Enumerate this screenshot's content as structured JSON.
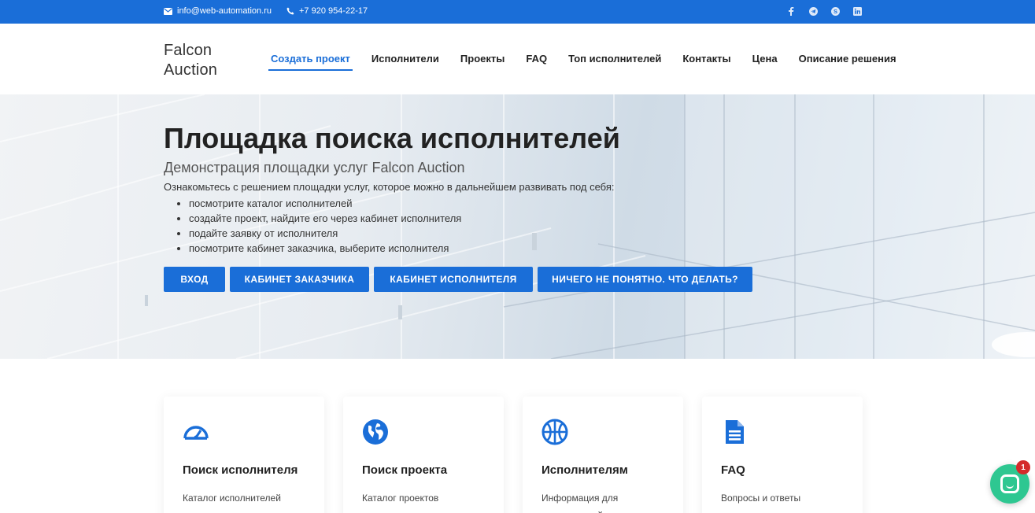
{
  "topbar": {
    "email": "info@web-automation.ru",
    "phone": "+7 920 954-22-17",
    "socials": [
      "facebook-icon",
      "telegram-icon",
      "skype-icon",
      "linkedin-icon"
    ]
  },
  "header": {
    "logo_line1": "Falcon",
    "logo_line2": "Auction",
    "nav": [
      {
        "label": "Создать проект",
        "active": true
      },
      {
        "label": "Исполнители"
      },
      {
        "label": "Проекты"
      },
      {
        "label": "FAQ"
      },
      {
        "label": "Топ исполнителей"
      },
      {
        "label": "Контакты"
      },
      {
        "label": "Цена"
      },
      {
        "label": "Описание решения"
      }
    ]
  },
  "hero": {
    "title": "Площадка поиска исполнителей",
    "subtitle": "Демонстрация площадки услуг Falcon Auction",
    "intro": "Ознакомьтесь с решением площадки услуг, которое можно в дальнейшем развивать под себя:",
    "list": [
      "посмотрите каталог исполнителей",
      "создайте проект, найдите его через кабинет исполнителя",
      "подайте заявку от исполнителя",
      "посмотрите кабинет заказчика, выберите исполнителя"
    ],
    "buttons": [
      "ВХОД",
      "КАБИНЕТ ЗАКАЗЧИКА",
      "КАБИНЕТ ИСПОЛНИТЕЛЯ",
      "НИЧЕГО НЕ ПОНЯТНО. ЧТО ДЕЛАТЬ?"
    ]
  },
  "cards": [
    {
      "icon": "speedometer-icon",
      "title": "Поиск исполнителя",
      "text": "Каталог исполнителей"
    },
    {
      "icon": "globe-icon",
      "title": "Поиск проекта",
      "text": "Каталог проектов"
    },
    {
      "icon": "basketball-icon",
      "title": "Исполнителям",
      "text": "Информация для исполнителей"
    },
    {
      "icon": "document-icon",
      "title": "FAQ",
      "text": "Вопросы и ответы"
    }
  ],
  "chat": {
    "badge": "1"
  },
  "colors": {
    "accent": "#1a6ed8",
    "chat": "#2ec791",
    "badge": "#d42b2b"
  }
}
